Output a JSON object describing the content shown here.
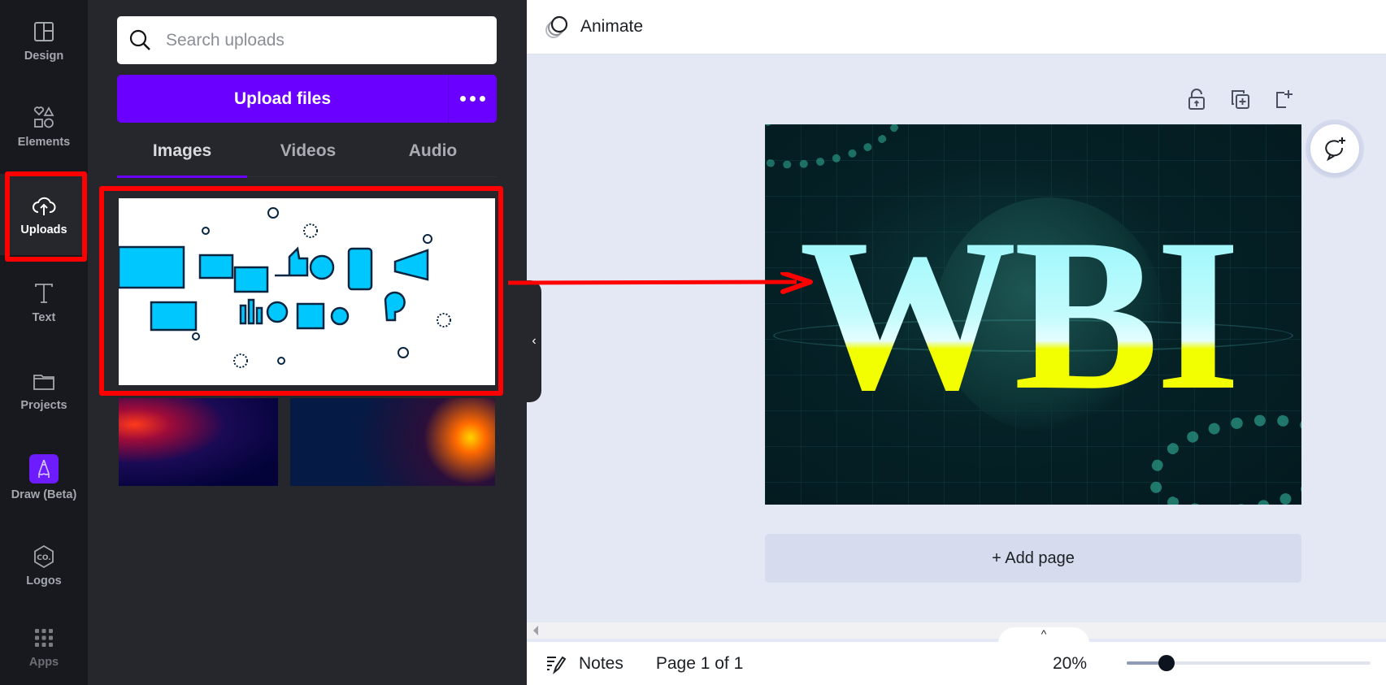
{
  "rail": {
    "items": [
      {
        "label": "Design",
        "icon": "layout-icon"
      },
      {
        "label": "Elements",
        "icon": "shapes-icon"
      },
      {
        "label": "Uploads",
        "icon": "cloud-upload-icon",
        "active": true
      },
      {
        "label": "Text",
        "icon": "text-t-icon"
      },
      {
        "label": "Projects",
        "icon": "folder-icon"
      },
      {
        "label": "Draw (Beta)",
        "icon": "pencil-icon"
      },
      {
        "label": "Logos",
        "icon": "logo-hexagon-icon"
      },
      {
        "label": "Apps",
        "icon": "apps-grid-icon"
      }
    ]
  },
  "panel": {
    "search": {
      "placeholder": "Search uploads",
      "value": ""
    },
    "upload_button": {
      "label": "Upload files"
    },
    "tabs": [
      {
        "label": "Images",
        "active": true
      },
      {
        "label": "Videos",
        "active": false
      },
      {
        "label": "Audio",
        "active": false
      }
    ],
    "thumbnails": [
      {
        "name": "business-icons-illustration",
        "highlighted": true
      },
      {
        "name": "red-circuit-board"
      },
      {
        "name": "colorful-circuit-board"
      }
    ]
  },
  "topbar": {
    "animate_label": "Animate"
  },
  "canvas": {
    "design_text": "WBI",
    "add_page_label": "+ Add page",
    "tools": [
      "unlock-icon",
      "duplicate-page-icon",
      "add-page-icon"
    ]
  },
  "footer": {
    "notes_label": "Notes",
    "page_label": "Page 1 of 1",
    "zoom_label": "20%",
    "zoom_fraction": 0.2,
    "pull_tab_glyph": "^"
  },
  "annotation": {
    "highlight_color": "#ff0000"
  },
  "colors": {
    "brand": "#6a00ff",
    "rail_bg": "#18191f",
    "panel_bg": "#25272c",
    "canvas_bg": "#e4e7f4"
  }
}
